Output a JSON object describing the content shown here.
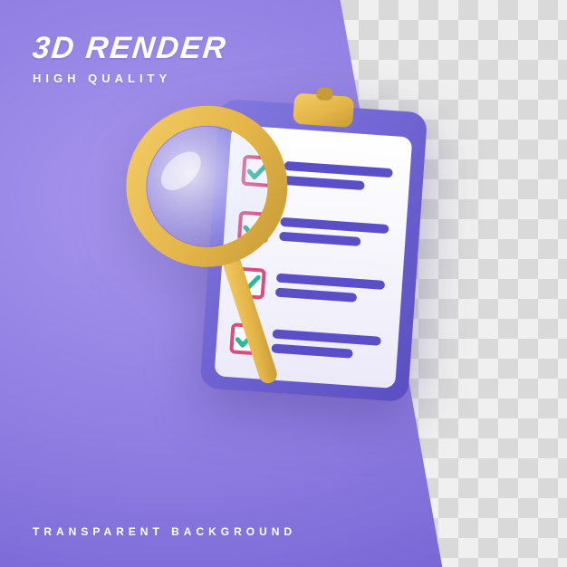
{
  "headline": {
    "title": "3D RENDER",
    "subtitle": "HIGH QUALITY"
  },
  "footer": {
    "caption": "TRANSPARENT BACKGROUND"
  },
  "illustration": {
    "clipboard_name": "clipboard-icon",
    "magnifier_name": "magnifying-glass-icon",
    "checklist_items": 4
  },
  "colors": {
    "purple_light": "#a997ef",
    "purple_mid": "#8c7ae0",
    "purple_deep": "#6d5bd0",
    "clipboard_board": "#6f63d6",
    "clipboard_paper": "#f6f4ff",
    "clipboard_line": "#5b4fc7",
    "checkbox_border": "#d84d7d",
    "checkmark": "#2fb79a",
    "magnifier_gold": "#e8b94a",
    "magnifier_gold_dark": "#caa03b",
    "clip_metal": "#d8a93e"
  }
}
